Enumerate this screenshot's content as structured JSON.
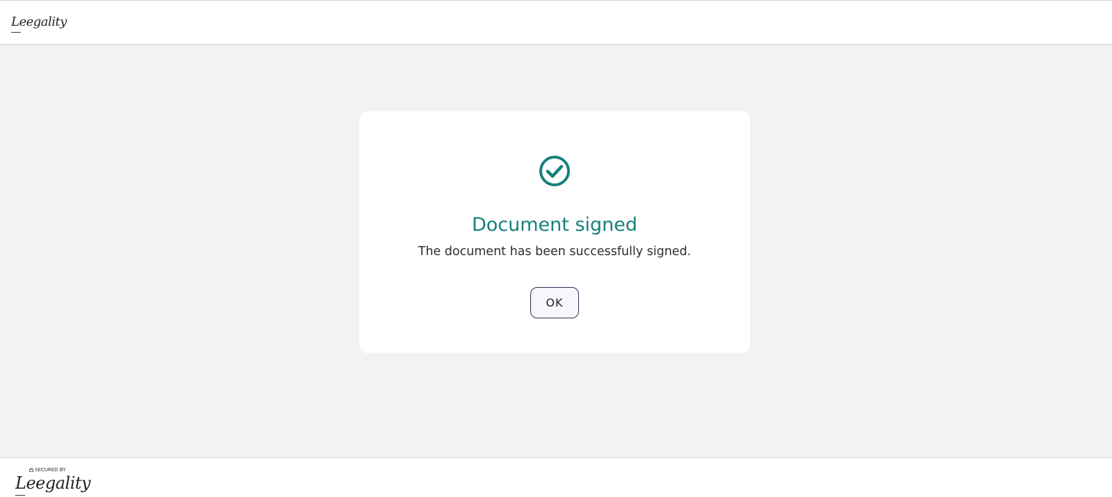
{
  "header": {
    "logo_text": "Leegality"
  },
  "dialog": {
    "icon": "check-circle-icon",
    "title": "Document signed",
    "message": "The document has been successfully signed.",
    "ok_label": "OK",
    "accent_color": "#16807a"
  },
  "footer": {
    "secured_by": "SECURED BY",
    "logo_text": "Leegality"
  }
}
